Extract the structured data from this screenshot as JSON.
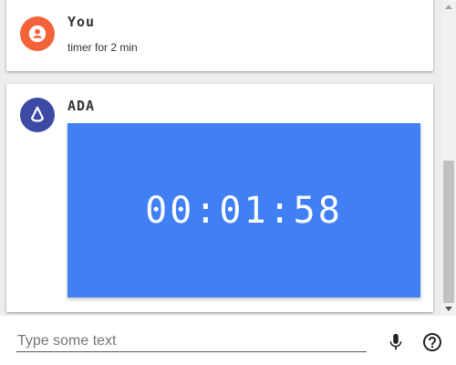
{
  "messages": [
    {
      "sender": "You",
      "text": "timer for 2 min",
      "avatar_icon": "person-icon",
      "avatar_color": "#f4623a"
    },
    {
      "sender": "ADA",
      "timer": "00:01:58",
      "avatar_icon": "ada-logo-icon",
      "avatar_color": "#3c4aa6",
      "timer_color": "#4080f4"
    }
  ],
  "input": {
    "placeholder": "Type some text",
    "value": ""
  },
  "icons": {
    "mic": "microphone-icon",
    "help": "help-circle-icon"
  }
}
